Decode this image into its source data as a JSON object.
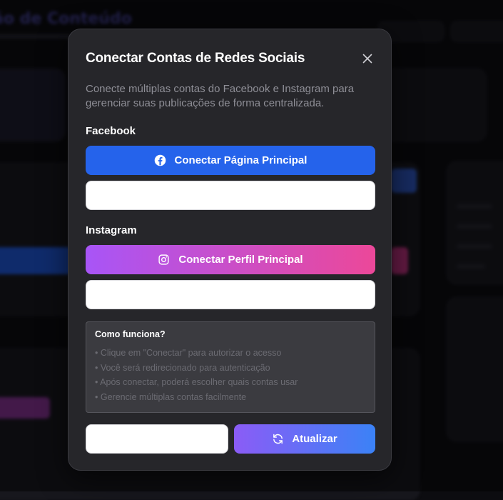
{
  "modal": {
    "title": "Conectar Contas de Redes Sociais",
    "description": "Conecte múltiplas contas do Facebook e Instagram para gerenciar suas publicações de forma centralizada.",
    "close_icon": "close-icon",
    "facebook": {
      "label": "Facebook",
      "button_label": "Conectar Página Principal",
      "icon": "facebook-icon",
      "color": "#2563eb",
      "field_value": ""
    },
    "instagram": {
      "label": "Instagram",
      "button_label": "Conectar Perfil Principal",
      "icon": "instagram-icon",
      "gradient": [
        "#a855f7",
        "#ec4899"
      ],
      "field_value": ""
    },
    "info": {
      "title": "Como funciona?",
      "items": [
        "Clique em \"Conectar\" para autorizar o acesso",
        "Você será redirecionado para autenticação",
        "Após conectar, poderá escolher quais contas usar",
        "Gerencie múltiplas contas facilmente"
      ]
    },
    "footer": {
      "cancel_label": "",
      "update_label": "Atualizar",
      "update_icon": "refresh-icon",
      "update_gradient": [
        "#8b5cf6",
        "#3b82f6"
      ]
    }
  }
}
